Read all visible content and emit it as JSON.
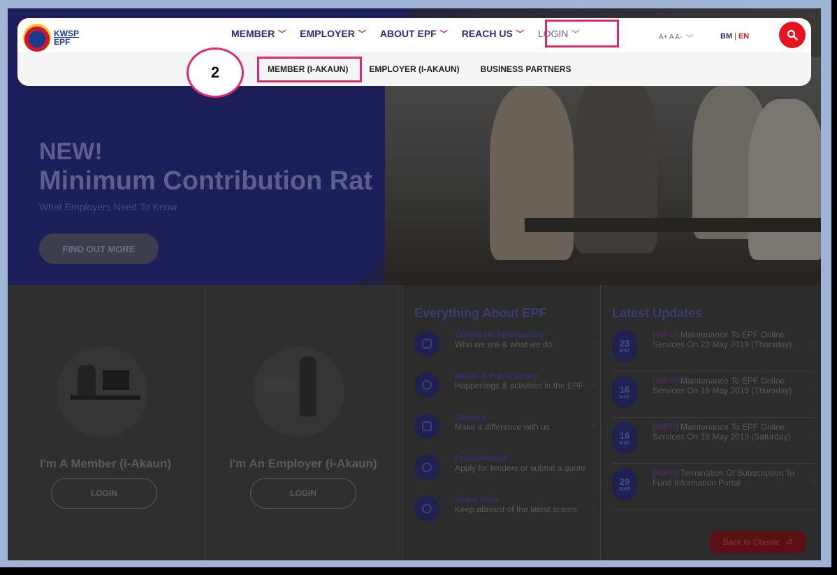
{
  "logo": {
    "line1": "KWSP",
    "line2": "EPF"
  },
  "nav": {
    "items": [
      {
        "label": "MEMBER"
      },
      {
        "label": "EMPLOYER"
      },
      {
        "label": "ABOUT EPF"
      },
      {
        "label": "REACH US"
      }
    ],
    "login": "LOGIN",
    "font_size": "A+ A A-",
    "lang_bm": "BM",
    "lang_en": "EN"
  },
  "subnav": {
    "items": [
      "MEMBER (I-AKAUN)",
      "EMPLOYER (I-AKAUN)",
      "BUSINESS PARTNERS"
    ],
    "step": "2"
  },
  "hero": {
    "new": "NEW!",
    "title": "Minimum Contribution Rat",
    "subtitle": "What Employers Need To Know",
    "cta": "FIND OUT MORE"
  },
  "member_panel": {
    "title": "I'm A Member (i-Akaun)",
    "button": "LOGIN"
  },
  "employer_panel": {
    "title": "I'm An Employer (i-Akaun)",
    "button": "LOGIN"
  },
  "about": {
    "title": "Everything About EPF",
    "items": [
      {
        "heading": "Corporate Information",
        "desc": "Who we are & what we do"
      },
      {
        "heading": "Media & Publications",
        "desc": "Happenings & activities in the EPF"
      },
      {
        "heading": "Careers",
        "desc": "Make a difference with us"
      },
      {
        "heading": "Procurement",
        "desc": "Apply for tenders or submit a quote"
      },
      {
        "heading": "Scam Alert",
        "desc": "Keep abreast of the latest scams"
      }
    ]
  },
  "updates": {
    "title": "Latest Updates",
    "items": [
      {
        "day": "23",
        "month": "MAY",
        "tag": "[INFO]",
        "text": " Maintenance To EPF Online Services On 23 May 2019 (Thursday)"
      },
      {
        "day": "16",
        "month": "MAY",
        "tag": "[INFO]",
        "text": " Maintenance To EPF Online Services On 16 May 2019 (Thursday)"
      },
      {
        "day": "16",
        "month": "MAY",
        "tag": "[INFO]",
        "text": " Maintenance To EPF Online Services On 18 May 2019 (Saturday)"
      },
      {
        "day": "29",
        "month": "MAR",
        "tag": "[INFO]",
        "text": " Termination Of Subscription To Fund Information Portal"
      }
    ]
  },
  "back_to_classic": "Back to Classic",
  "colors": {
    "brand_blue": "#2a2b78",
    "accent_red": "#e7141e",
    "highlight": "#e0286e"
  }
}
